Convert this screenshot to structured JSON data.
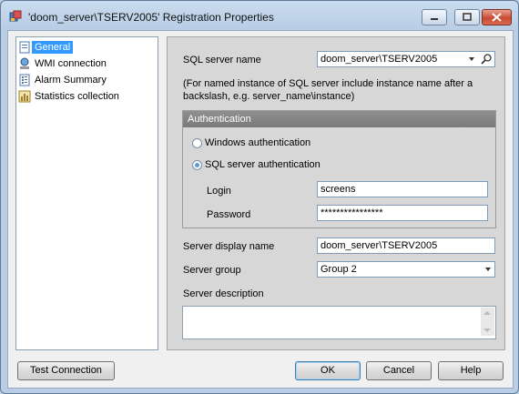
{
  "window": {
    "title": "'doom_server\\TSERV2005' Registration Properties"
  },
  "tree": {
    "items": [
      {
        "label": "General",
        "icon": "general-page-icon",
        "selected": true
      },
      {
        "label": "WMI connection",
        "icon": "wmi-icon",
        "selected": false
      },
      {
        "label": "Alarm Summary",
        "icon": "alarm-list-icon",
        "selected": false
      },
      {
        "label": "Statistics collection",
        "icon": "statistics-icon",
        "selected": false
      }
    ]
  },
  "general": {
    "sql_server_name_label": "SQL server name",
    "sql_server_name_value": "doom_server\\TSERV2005",
    "note": "(For named instance of SQL server include instance name after a backslash, e.g. server_name\\instance)",
    "authentication": {
      "header": "Authentication",
      "windows_auth_label": "Windows authentication",
      "sql_auth_label": "SQL server authentication",
      "selected": "SQL server authentication",
      "login_label": "Login",
      "login_value": "screens",
      "password_label": "Password",
      "password_value": "****************"
    },
    "display_name_label": "Server display name",
    "display_name_value": "doom_server\\TSERV2005",
    "group_label": "Server group",
    "group_value": "Group 2",
    "description_label": "Server description",
    "description_value": ""
  },
  "buttons": {
    "test_connection": "Test Connection",
    "ok": "OK",
    "cancel": "Cancel",
    "help": "Help"
  },
  "colors": {
    "selection": "#3399ff",
    "auth_header": "#858585",
    "close_button": "#c94b33"
  }
}
